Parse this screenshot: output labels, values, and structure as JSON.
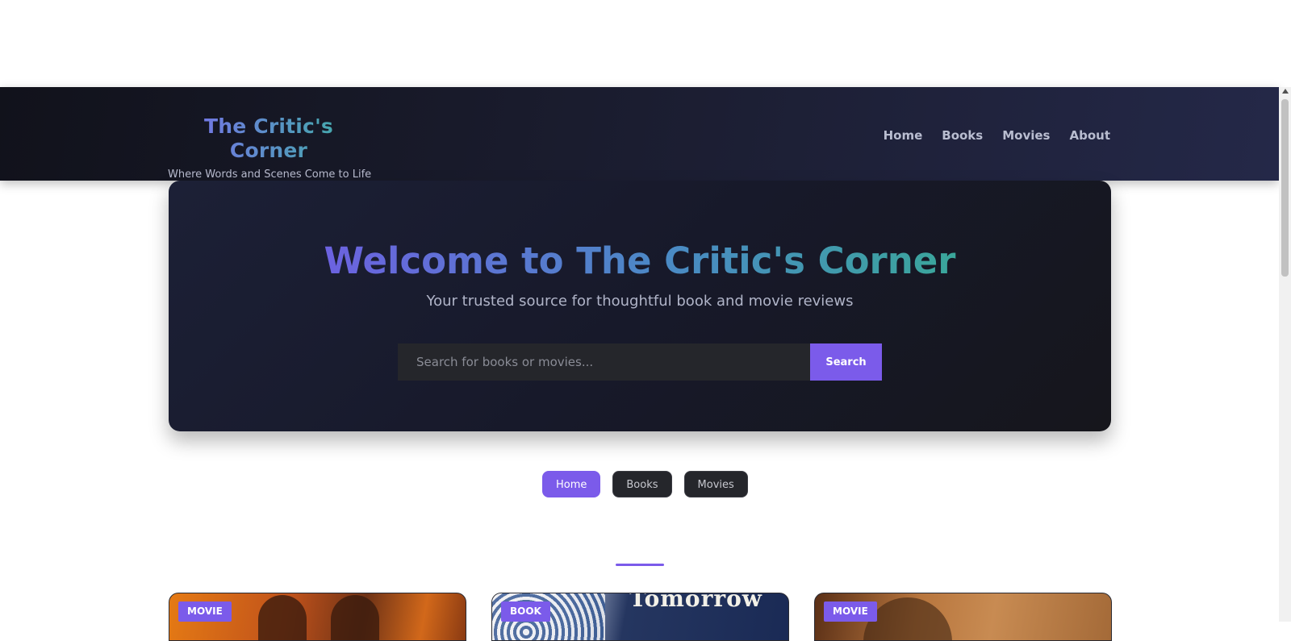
{
  "header": {
    "brand_title": "The Critic's Corner",
    "tagline": "Where Words and Scenes Come to Life",
    "nav": [
      "Home",
      "Books",
      "Movies",
      "About"
    ]
  },
  "hero": {
    "title": "Welcome to The Critic's Corner",
    "subtitle": "Your trusted source for thoughtful book and movie reviews",
    "search_placeholder": "Search for books or movies...",
    "search_button": "Search"
  },
  "filters": {
    "items": [
      "Home",
      "Books",
      "Movies"
    ],
    "active": "Home"
  },
  "cards": [
    {
      "badge": "MOVIE"
    },
    {
      "badge": "BOOK",
      "poster_text": "Tomorrow"
    },
    {
      "badge": "MOVIE"
    }
  ],
  "colors": {
    "accent": "#7b5bea",
    "header_bg": "#1a1c2e",
    "hero_bg": "#17192a"
  }
}
